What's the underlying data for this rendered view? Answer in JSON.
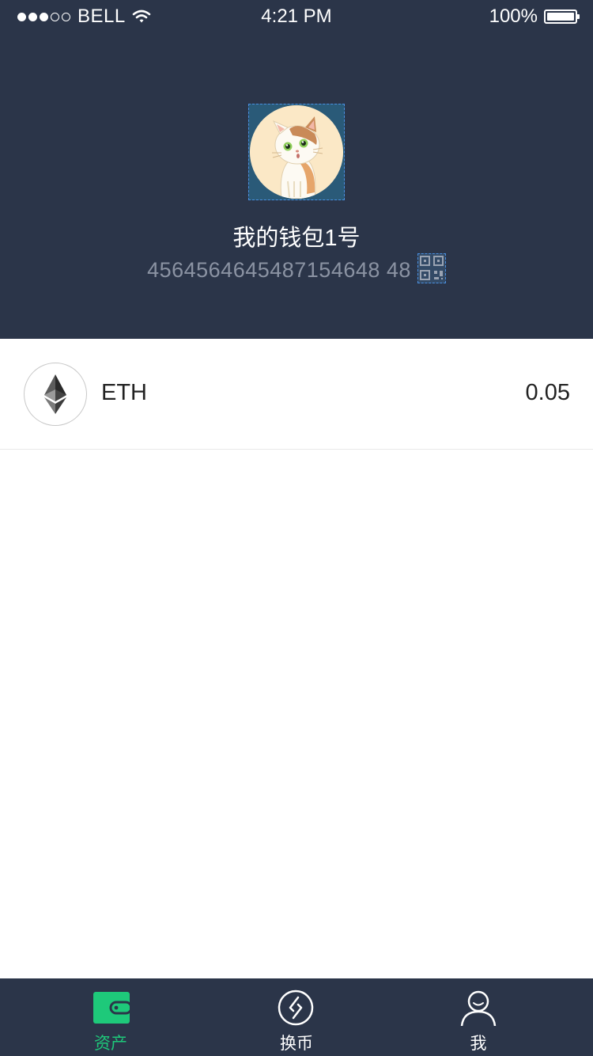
{
  "status_bar": {
    "carrier": "BELL",
    "time": "4:21 PM",
    "battery": "100%"
  },
  "wallet": {
    "name": "我的钱包1号",
    "address": "4564564645487154648 48"
  },
  "assets": [
    {
      "symbol": "ETH",
      "balance": "0.05",
      "icon": "ethereum-icon"
    }
  ],
  "tabbar": {
    "tabs": [
      {
        "label": "资产",
        "icon": "wallet-icon",
        "active": true
      },
      {
        "label": "换币",
        "icon": "exchange-icon",
        "active": false
      },
      {
        "label": "我",
        "icon": "user-icon",
        "active": false
      }
    ]
  },
  "colors": {
    "header_bg": "#2b3549",
    "accent_green": "#1ec97a",
    "address_gray": "#8b93a3"
  }
}
